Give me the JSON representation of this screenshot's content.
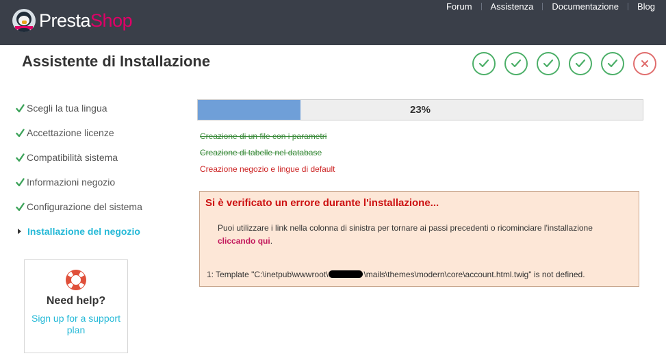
{
  "header": {
    "logo": {
      "part1": "Presta",
      "part2": "Shop"
    },
    "nav": [
      "Forum",
      "Assistenza",
      "Documentazione",
      "Blog"
    ]
  },
  "page_title": "Assistente di Installazione",
  "steps": [
    {
      "status": "done",
      "icon": "check-icon"
    },
    {
      "status": "done",
      "icon": "check-icon"
    },
    {
      "status": "done",
      "icon": "check-icon"
    },
    {
      "status": "done",
      "icon": "check-icon"
    },
    {
      "status": "done",
      "icon": "check-icon"
    },
    {
      "status": "error",
      "icon": "close-icon"
    }
  ],
  "sidebar": {
    "items": [
      {
        "label": "Scegli la tua lingua",
        "state": "done"
      },
      {
        "label": "Accettazione licenze",
        "state": "done"
      },
      {
        "label": "Compatibilità sistema",
        "state": "done"
      },
      {
        "label": "Informazioni negozio",
        "state": "done"
      },
      {
        "label": "Configurazione del sistema",
        "state": "done"
      },
      {
        "label": "Installazione del negozio",
        "state": "active"
      }
    ]
  },
  "help": {
    "title": "Need help?",
    "link": "Sign up for a support plan"
  },
  "progress": {
    "value": 0.23,
    "label": "23%"
  },
  "tasks": [
    {
      "label": "Creazione di un file con i parametri",
      "state": "done"
    },
    {
      "label": "Creazione di tabelle nel database",
      "state": "done"
    },
    {
      "label": "Creazione negozio e lingue di default",
      "state": "current"
    }
  ],
  "error": {
    "title": "Si è verificato un errore durante l'installazione...",
    "message": "Puoi utilizzare i link nella colonna di sinistra per tornare ai passi precedenti o ricominciare l'installazione",
    "link": "cliccando qui",
    "detail_prefix": "1: Template \"C:\\inetpub\\wwwroot\\",
    "detail_suffix": "\\mails\\themes\\modern\\core\\account.html.twig\" is not defined."
  },
  "colors": {
    "header_bg": "#3a3f49",
    "brand": "#df0067",
    "success": "#4caf68",
    "error": "#cc1111",
    "link": "#25b9d7"
  }
}
